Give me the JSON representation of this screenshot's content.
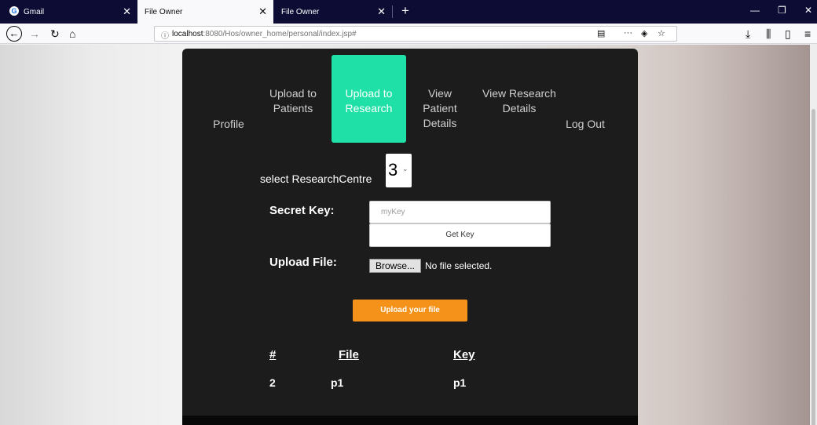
{
  "browser": {
    "tabs": [
      {
        "title": "Gmail",
        "active": false,
        "favicon": "G"
      },
      {
        "title": "File Owner",
        "active": true
      },
      {
        "title": "File Owner",
        "active": false
      }
    ],
    "url_host": "localhost",
    "url_rest": ":8080/Hos/owner_home/personal/index.jsp#"
  },
  "nav": {
    "items": [
      {
        "label": "Profile"
      },
      {
        "label": "Upload to Patients"
      },
      {
        "label": "Upload to Research",
        "active": true
      },
      {
        "label": "View Patient Details"
      },
      {
        "label": "View Research Details"
      },
      {
        "label": "Log Out"
      }
    ],
    "accent": "#1fe0a6"
  },
  "form": {
    "select_label": "select ResearchCentre",
    "select_value": "3",
    "secret_key_label": "Secret Key:",
    "secret_key_placeholder": "myKey",
    "get_key_label": "Get Key",
    "upload_file_label": "Upload File:",
    "browse_label": "Browse...",
    "file_status": "No file selected.",
    "upload_button": "Upload your file",
    "upload_color": "#f5921a"
  },
  "table": {
    "headers": [
      "#",
      "File",
      "Key"
    ],
    "rows": [
      [
        "2",
        "p1",
        "p1"
      ]
    ]
  }
}
